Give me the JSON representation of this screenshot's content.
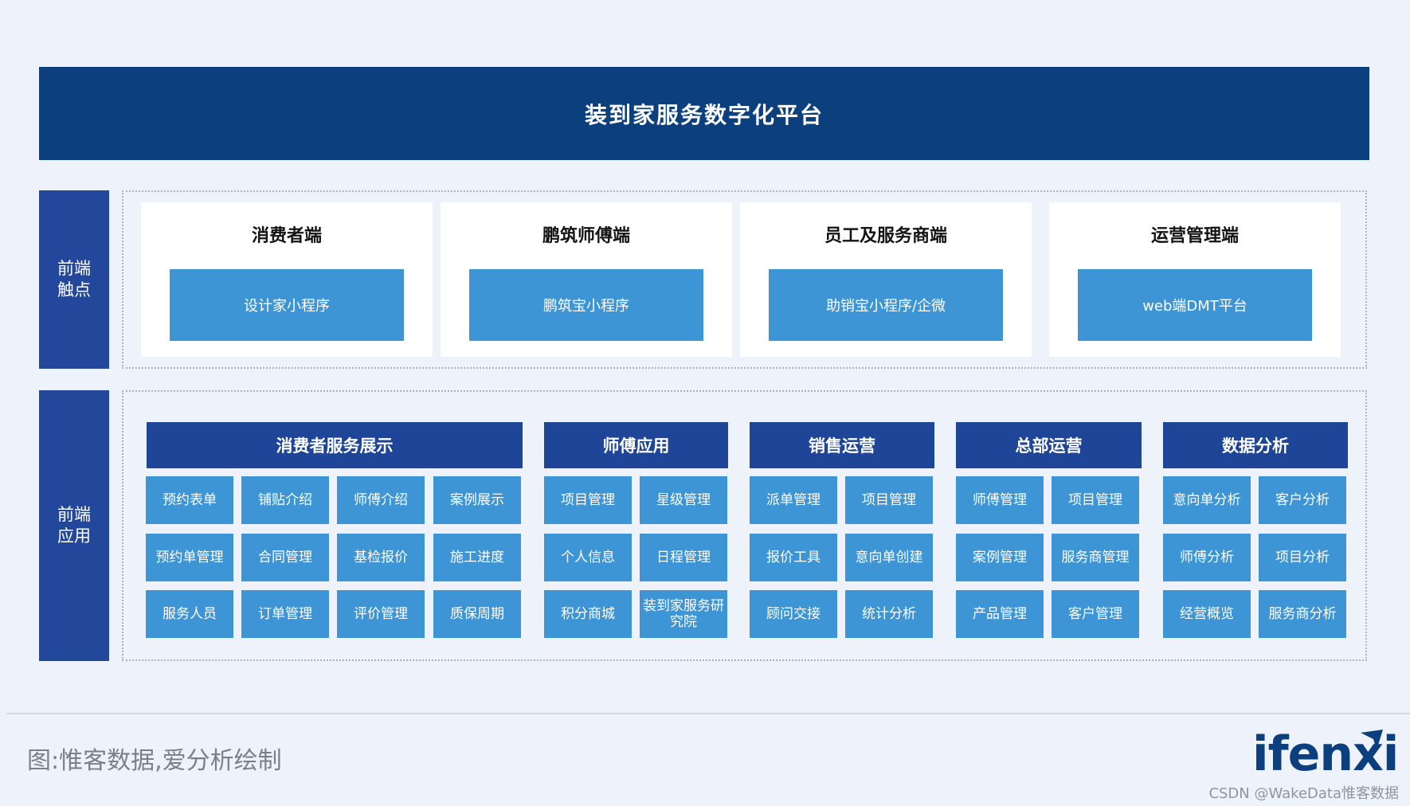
{
  "title": "装到家服务数字化平台",
  "sections": {
    "front": "前端触点",
    "app": "前端应用"
  },
  "clients": [
    {
      "title": "消费者端",
      "app": "设计家小程序"
    },
    {
      "title": "鹏筑师傅端",
      "app": "鹏筑宝小程序"
    },
    {
      "title": "员工及服务商端",
      "app": "助销宝小程序/企微"
    },
    {
      "title": "运营管理端",
      "app": "web端DMT平台"
    }
  ],
  "groups": [
    {
      "title": "消费者服务展示",
      "items": [
        "预约表单",
        "铺贴介绍",
        "师傅介绍",
        "案例展示",
        "预约单管理",
        "合同管理",
        "基检报价",
        "施工进度",
        "服务人员",
        "订单管理",
        "评价管理",
        "质保周期"
      ]
    },
    {
      "title": "师傅应用",
      "items": [
        "项目管理",
        "星级管理",
        "个人信息",
        "日程管理",
        "积分商城",
        "装到家服务研究院"
      ]
    },
    {
      "title": "销售运营",
      "items": [
        "派单管理",
        "项目管理",
        "报价工具",
        "意向单创建",
        "顾问交接",
        "统计分析"
      ]
    },
    {
      "title": "总部运营",
      "items": [
        "师傅管理",
        "项目管理",
        "案例管理",
        "服务商管理",
        "产品管理",
        "客户管理"
      ]
    },
    {
      "title": "数据分析",
      "items": [
        "意向单分析",
        "客户分析",
        "师傅分析",
        "项目分析",
        "经营概览",
        "服务商分析"
      ]
    }
  ],
  "caption": "图:惟客数据,爱分析绘制",
  "logo": "ifenxi",
  "watermark": "CSDN @WakeData惟客数据",
  "colors": {
    "title_bar": "#0c3f7e",
    "section_label": "#23479b",
    "group_header": "#1e4597",
    "tile": "#3d95d6",
    "background": "#eef2fa"
  }
}
